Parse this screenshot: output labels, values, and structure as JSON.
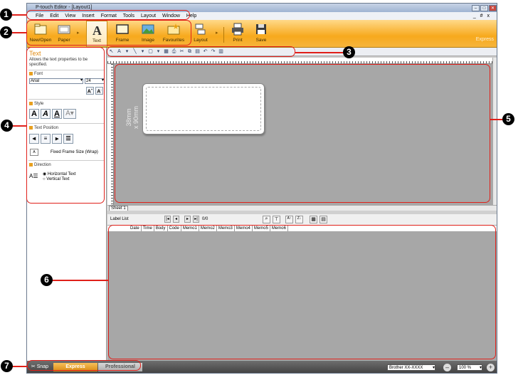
{
  "window_title": "P-touch Editor - [Layout1]",
  "menu": [
    "File",
    "Edit",
    "View",
    "Insert",
    "Format",
    "Tools",
    "Layout",
    "Window",
    "Help"
  ],
  "ribbon": {
    "items": [
      "New/Open",
      "Paper",
      "Text",
      "Frame",
      "Image",
      "Favourites",
      "Layout",
      "Print",
      "Save"
    ],
    "mode_label": "Express"
  },
  "sidebar": {
    "title": "Text",
    "description": "Allows the text properties to be specified.",
    "font_header": "Font",
    "font_name": "Arial",
    "font_size": "24",
    "style_header": "Style",
    "text_position_header": "Text Position",
    "fixed_frame": "Fixed Frame Size (Wrap)",
    "direction_header": "Direction",
    "horizontal": "Horizontal Text",
    "vertical": "Vertical Text"
  },
  "canvas": {
    "label_size_1": "38mm",
    "label_size_2": "x 90mm",
    "sheet_tab": "Sheet 1"
  },
  "label_list": {
    "title": "Label List",
    "record": "0/0",
    "columns": [
      "Date",
      "Time",
      "Body",
      "Code",
      "Memo1",
      "Memo2",
      "Memo3",
      "Memo4",
      "Memo5",
      "Memo6"
    ]
  },
  "status": {
    "snap": "Snap",
    "express": "Express",
    "professional": "Professional",
    "printer": "Brother XX-XXXX",
    "zoom": "100 %"
  },
  "markers": [
    "1",
    "2",
    "3",
    "4",
    "5",
    "6",
    "7"
  ]
}
